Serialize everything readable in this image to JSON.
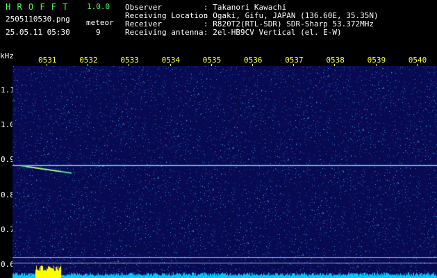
{
  "app": {
    "name": "H R O F F T",
    "version": "1.0.0"
  },
  "file": {
    "filename": "2505110530.png",
    "datetime": "25.05.11 05:30"
  },
  "meteor": {
    "label": "meteor",
    "count": "9"
  },
  "info": {
    "observer_label": "Observer",
    "observer_value": ": Takanori Kawachi",
    "location_label": "Receiving Location",
    "location_value": ": Ogaki, Gifu, JAPAN (136.60E, 35.35N)",
    "receiver_label": "Receiver",
    "receiver_value": ": R820T2(RTL-SDR) SDR-Sharp 53.372MHz",
    "antenna_label": "Receiving antenna",
    "antenna_value": ": 2el-HB9CV Vertical (el. E-W)"
  },
  "axis": {
    "y_unit": "kHz",
    "x_ticks": [
      "0531",
      "0532",
      "0533",
      "0534",
      "0535",
      "0536",
      "0537",
      "0538",
      "0539",
      "0540"
    ],
    "y_ticks": [
      "1.1",
      "1.0",
      "0.9",
      "0.8",
      "0.7",
      "0.6"
    ]
  },
  "colors": {
    "background": "#0a0a50",
    "carrier": "#7fd8ff",
    "meteor": "#ffff66",
    "tick": "#ffff33",
    "app": "#4cff4c"
  }
}
